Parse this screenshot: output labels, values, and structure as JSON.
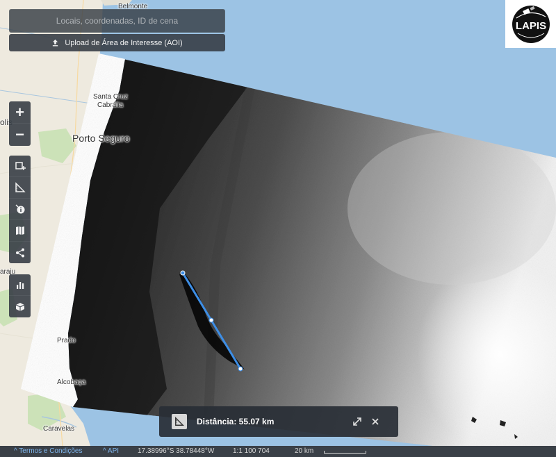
{
  "search": {
    "placeholder": "Locais, coordenadas, ID de cena"
  },
  "upload": {
    "label": "Upload de Área de Interesse (AOI)"
  },
  "logo": {
    "text": "LAPIS"
  },
  "map": {
    "place_labels": {
      "belmonte": "Belmonte",
      "santa_cruz": "Santa Cruz",
      "cabralia": "Cabrália",
      "porto_seguro": "Porto Seguro",
      "olis": "olis",
      "araju": "araju",
      "prado": "Prado",
      "alcobaca": "Alcobaça",
      "caravelas": "Caravelas"
    },
    "colors": {
      "ocean": "#9cc3e4",
      "land": "#eeeadf",
      "forest": "#cce2b8",
      "measure_line": "#3d8ee6"
    }
  },
  "toolbar": {
    "zoom_in": "+",
    "zoom_out": "−"
  },
  "measure": {
    "label": "Distância: 55.07 km"
  },
  "statusbar": {
    "terms": "Termos e Condições",
    "api": "API",
    "coords": "17.38996°S 38.78448°W",
    "scale": "1:1 100 704",
    "scalebar": "20 km"
  }
}
